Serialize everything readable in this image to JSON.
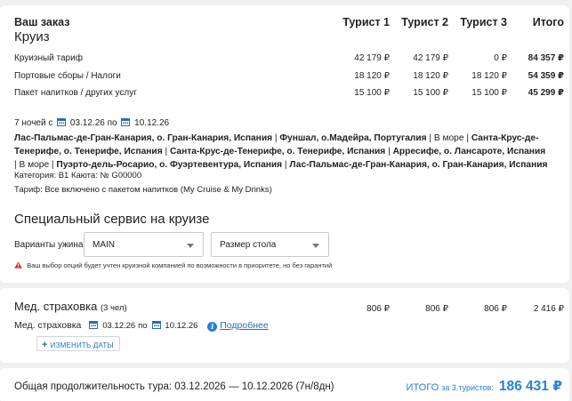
{
  "order": {
    "title": "Ваш заказ",
    "subtitle": "Круиз",
    "columns": [
      "Турист 1",
      "Турист 2",
      "Турист 3",
      "Итого"
    ],
    "rows": [
      {
        "label": "Круизный тариф",
        "values": [
          "42 179 ₽",
          "42 179 ₽",
          "0 ₽",
          "84 357 ₽"
        ]
      },
      {
        "label": "Портовые сборы / Налоги",
        "values": [
          "18 120 ₽",
          "18 120 ₽",
          "18 120 ₽",
          "54 359 ₽"
        ]
      },
      {
        "label": "Пакет напитков / других услуг",
        "values": [
          "15 100 ₽",
          "15 100 ₽",
          "15 100 ₽",
          "45 299 ₽"
        ]
      }
    ]
  },
  "cruise": {
    "nights": "7 ночей с",
    "date_from": "03.12.26",
    "by": "по",
    "date_to": "10.12.26",
    "route_segments": [
      {
        "text": "Лас-Пальмас-де-Гран-Канария, о. Гран-Канария, Испания",
        "bold": true
      },
      {
        "text": " | ",
        "bold": false
      },
      {
        "text": "Фуншал, о.Мадейра, Португалия",
        "bold": true
      },
      {
        "text": " | В море | ",
        "bold": false
      },
      {
        "text": "Санта-Крус-де-Тенерифе, о. Тенерифе, Испания",
        "bold": true
      },
      {
        "text": " | ",
        "bold": false
      },
      {
        "text": "Санта-Крус-де-Тенерифе, о. Тенерифе, Испания",
        "bold": true
      },
      {
        "text": " | ",
        "bold": false
      },
      {
        "text": "Арресифе, о. Лансароте, Испания",
        "bold": true
      },
      {
        "text": " | В море | ",
        "bold": false
      },
      {
        "text": "Пуэрто-дель-Росарио, о. Фуэртевентура, Испания",
        "bold": true
      },
      {
        "text": " | ",
        "bold": false
      },
      {
        "text": "Лас-Пальмас-де-Гран-Канария, о. Гран-Канария, Испания",
        "bold": true
      }
    ],
    "category": "Категория: B1   Каюта: № G00000",
    "tariff": "Тариф: Все включено с пакетом напитков (My Cruise & My Drinks)"
  },
  "special": {
    "title": "Специальный сервис на круизе",
    "dinner_label": "Варианты ужина",
    "dinner_value": "MAIN",
    "table_value": "Размер стола",
    "warning": "Ваш выбор опций будет учтен круизной компанией по возможности в приоритете, но без гарантий"
  },
  "insurance": {
    "title": "Мед. страховка",
    "count": "(3 чел)",
    "values": [
      "806 ₽",
      "806 ₽",
      "806 ₽",
      "2 416 ₽"
    ],
    "label": "Мед. страховка",
    "date_from": "03.12.26",
    "by": "по",
    "date_to": "10.12.26",
    "more_link": "Подробнее",
    "change_dates": "ИЗМЕНИТЬ ДАТЫ"
  },
  "footer": {
    "duration": "Общая продолжительность тура: 03.12.2026 — 10.12.2026 (7н/8дн)",
    "total_label": "ИТОГО",
    "total_for": "за 3 туристов:",
    "total_value": "186 431 ₽"
  },
  "colors": {
    "accent": "#2a6db0",
    "total": "#2a7fd4",
    "warning": "#d9342b"
  }
}
